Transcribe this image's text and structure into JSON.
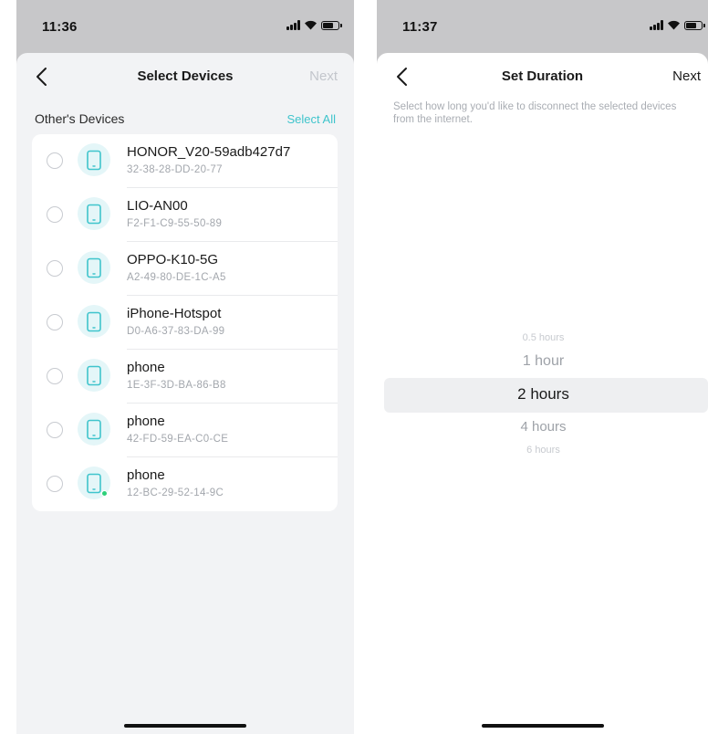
{
  "left": {
    "status": {
      "time": "11:36"
    },
    "nav": {
      "title": "Select Devices",
      "next_label": "Next"
    },
    "section": {
      "title": "Other's Devices",
      "select_all_label": "Select All"
    },
    "devices": [
      {
        "name": "HONOR_V20-59adb427d7",
        "mac": "32-38-28-DD-20-77"
      },
      {
        "name": "LIO-AN00",
        "mac": "F2-F1-C9-55-50-89"
      },
      {
        "name": "OPPO-K10-5G",
        "mac": "A2-49-80-DE-1C-A5"
      },
      {
        "name": "iPhone-Hotspot",
        "mac": "D0-A6-37-83-DA-99"
      },
      {
        "name": "phone",
        "mac": "1E-3F-3D-BA-86-B8"
      },
      {
        "name": "phone",
        "mac": "42-FD-59-EA-C0-CE"
      },
      {
        "name": "phone",
        "mac": "12-BC-29-52-14-9C",
        "online": true
      }
    ]
  },
  "right": {
    "status": {
      "time": "11:37"
    },
    "nav": {
      "title": "Set Duration",
      "next_label": "Next"
    },
    "description": "Select how long you'd like to disconnect the selected devices from the internet.",
    "picker": {
      "options": [
        "0.5 hours",
        "1 hour",
        "2 hours",
        "4 hours",
        "6 hours"
      ],
      "selected": "2 hours"
    }
  },
  "colors": {
    "accent": "#3fc4cc",
    "online": "#2dd07a",
    "icon_bg": "#e4f6f8",
    "disabled_text": "#c3c6cc"
  }
}
